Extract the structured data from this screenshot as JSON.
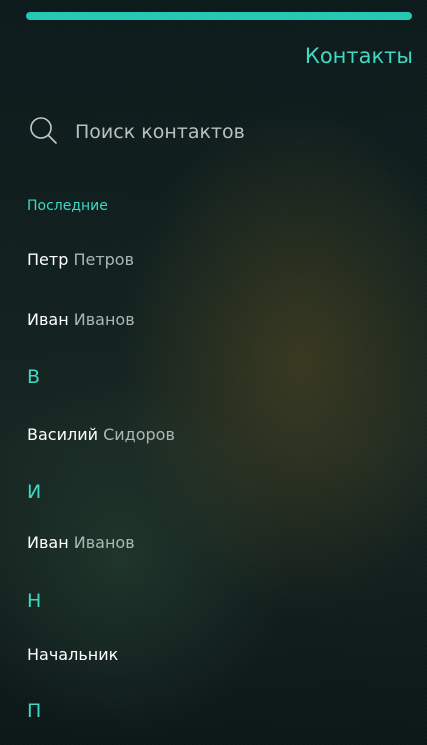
{
  "header": {
    "title": "Контакты"
  },
  "search": {
    "placeholder": "Поиск контактов",
    "icon": "search-icon"
  },
  "sections": {
    "recent_label": "Последние",
    "letter_v": "В",
    "letter_i": "И",
    "letter_n": "Н",
    "letter_p": "П"
  },
  "contacts": [
    {
      "first": "Петр",
      "last": "Петров"
    },
    {
      "first": "Иван",
      "last": "Иванов"
    },
    {
      "first": "Василий",
      "last": "Сидоров"
    },
    {
      "first": "Иван",
      "last": "Иванов"
    },
    {
      "first": "Начальник",
      "last": ""
    }
  ],
  "colors": {
    "accent": "#25c7b2",
    "secondary_text": "#aeb6b5",
    "primary_text": "#ffffff"
  }
}
